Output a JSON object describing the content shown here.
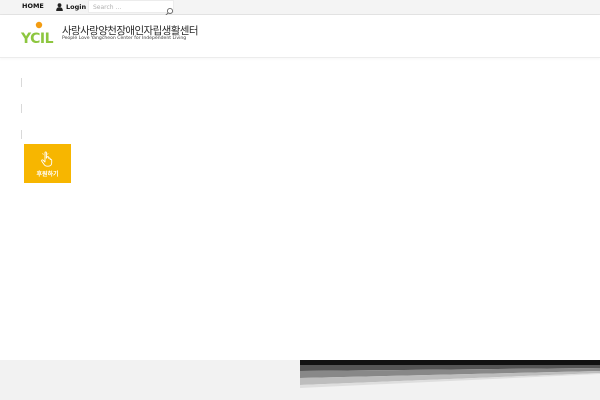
{
  "topbar": {
    "home_label": "HOME",
    "login_label": "Login",
    "search_placeholder": "Search ..."
  },
  "header": {
    "logo_mark_text": "YCIL",
    "logo_title": "사랑사랑양천장애인자립생활센터",
    "logo_subtitle": "People Love Yangcheon Center for Independent Living"
  },
  "donate": {
    "label": "후원하기"
  },
  "colors": {
    "accent": "#f7b600",
    "logo_green": "#8dc63f",
    "logo_orange": "#f39c12"
  },
  "icons": {
    "login": "user-icon",
    "search": "search-icon",
    "donate": "pointing-hand-icon"
  }
}
